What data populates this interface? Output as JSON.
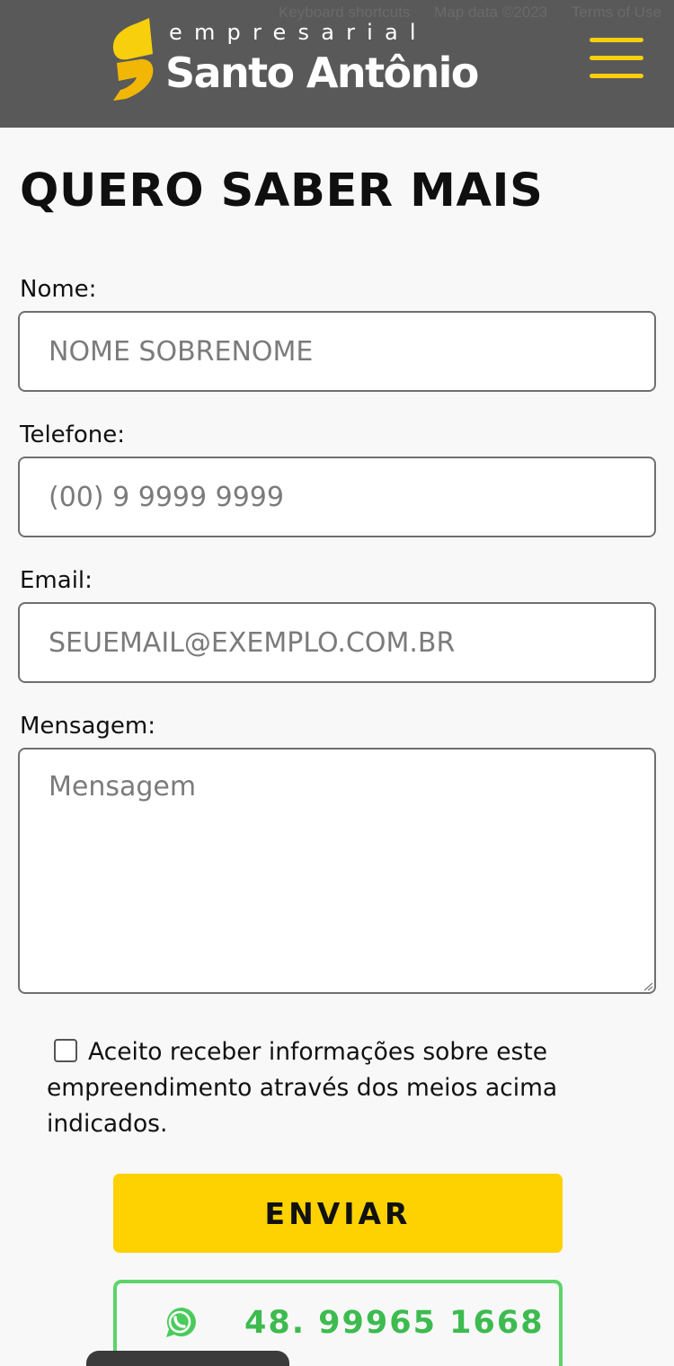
{
  "header": {
    "map_credits": {
      "shortcuts": "Keyboard shortcuts",
      "map_data": "Map data ©2023",
      "terms": "Terms of Use"
    },
    "logo": {
      "subtitle": "empresarial",
      "name": "Santo Antônio",
      "icon": "santo-antonio-s-logo"
    },
    "menu_icon": "hamburger-menu-icon",
    "colors": {
      "background": "#595959",
      "accent": "#F7CF0C"
    }
  },
  "form": {
    "title": "QUERO SABER MAIS",
    "fields": {
      "name": {
        "label": "Nome:",
        "placeholder": "NOME SOBRENOME",
        "value": ""
      },
      "phone": {
        "label": "Telefone:",
        "placeholder": "(00) 9 9999 9999",
        "value": ""
      },
      "email": {
        "label": "Email:",
        "placeholder": "SEUEMAIL@EXEMPLO.COM.BR",
        "value": ""
      },
      "message": {
        "label": "Mensagem:",
        "placeholder": "Mensagem",
        "value": ""
      }
    },
    "consent": {
      "text": "Aceito receber informações sobre este empreendimento através dos meios acima indicados.",
      "checked": false
    },
    "submit_label": "ENVIAR",
    "whatsapp": {
      "number": "48. 99965 1668",
      "icon": "whatsapp-icon",
      "color": "#3DBB4F"
    },
    "colors": {
      "submit": "#FDD200"
    }
  }
}
